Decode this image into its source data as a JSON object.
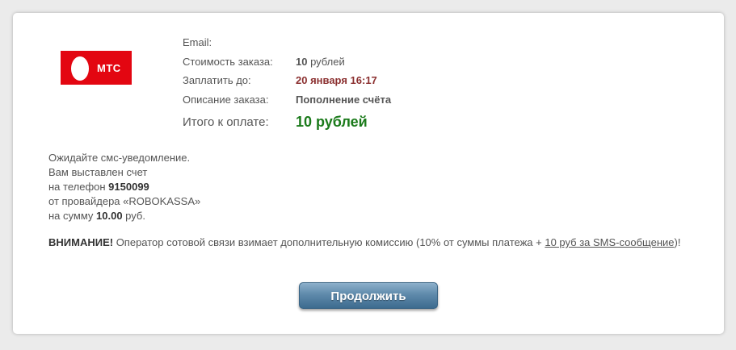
{
  "logo": {
    "text": "МТС",
    "brand_color": "#e30611",
    "icon": "mts-egg-icon"
  },
  "order": {
    "email_label": "Email:",
    "email_value": "",
    "cost_label": "Стоимость заказа:",
    "cost_amount": "10",
    "cost_unit": " рублей",
    "pay_until_label": "Заплатить до:",
    "pay_until_value": "20 января 16:17",
    "description_label": "Описание заказа:",
    "description_value": "Пополнение счёта",
    "total_label": "Итого к оплате:",
    "total_value": "10 рублей"
  },
  "message": {
    "line1": "Ожидайте смс-уведомление.",
    "line2": "Вам выставлен счет",
    "line3_prefix": "на телефон ",
    "phone": "9150099",
    "line4": "от провайдера «ROBOKASSA»",
    "line5_prefix": "на сумму ",
    "amount": "10.00",
    "line5_suffix": " руб."
  },
  "warning": {
    "title": "ВНИМАНИЕ!",
    "text": " Оператор сотовой связи взимает дополнительную комиссию (10% от суммы платежа + ",
    "link": "10 руб за SMS-сообщение",
    "suffix": ")!"
  },
  "button": {
    "label": "Продолжить"
  },
  "colors": {
    "accent_red": "#8b3030",
    "total_green": "#1a7a1a",
    "button_blue": "#5f8aab"
  }
}
